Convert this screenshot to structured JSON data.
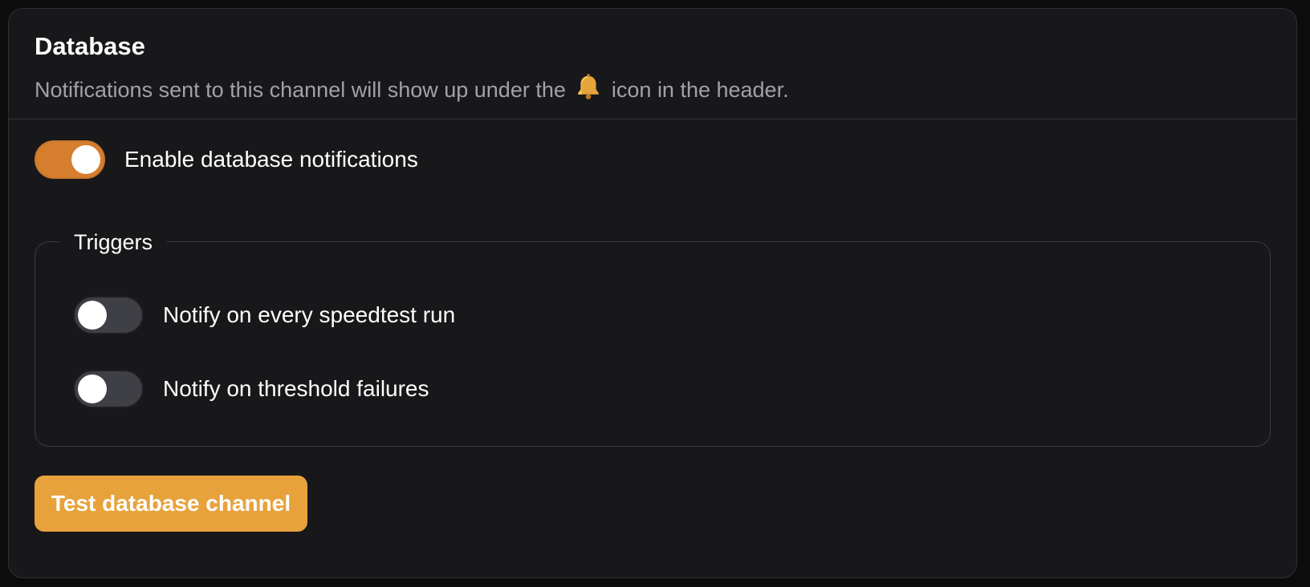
{
  "card": {
    "title": "Database",
    "description_before": "Notifications sent to this channel will show up under the",
    "description_icon": "bell-icon",
    "description_after": "icon in the header."
  },
  "enable_toggle": {
    "label": "Enable database notifications",
    "checked": true
  },
  "triggers": {
    "legend": "Triggers",
    "items": [
      {
        "label": "Notify on every speedtest run",
        "checked": false
      },
      {
        "label": "Notify on threshold failures",
        "checked": false
      }
    ]
  },
  "actions": {
    "test_label": "Test database channel"
  },
  "colors": {
    "accent": "#e8a23c",
    "toggle_on": "#d47e2e",
    "toggle_off": "#3f3f46",
    "card_bg": "#18181b",
    "page_bg": "#0c0c0d",
    "muted_text": "#a1a1aa"
  }
}
